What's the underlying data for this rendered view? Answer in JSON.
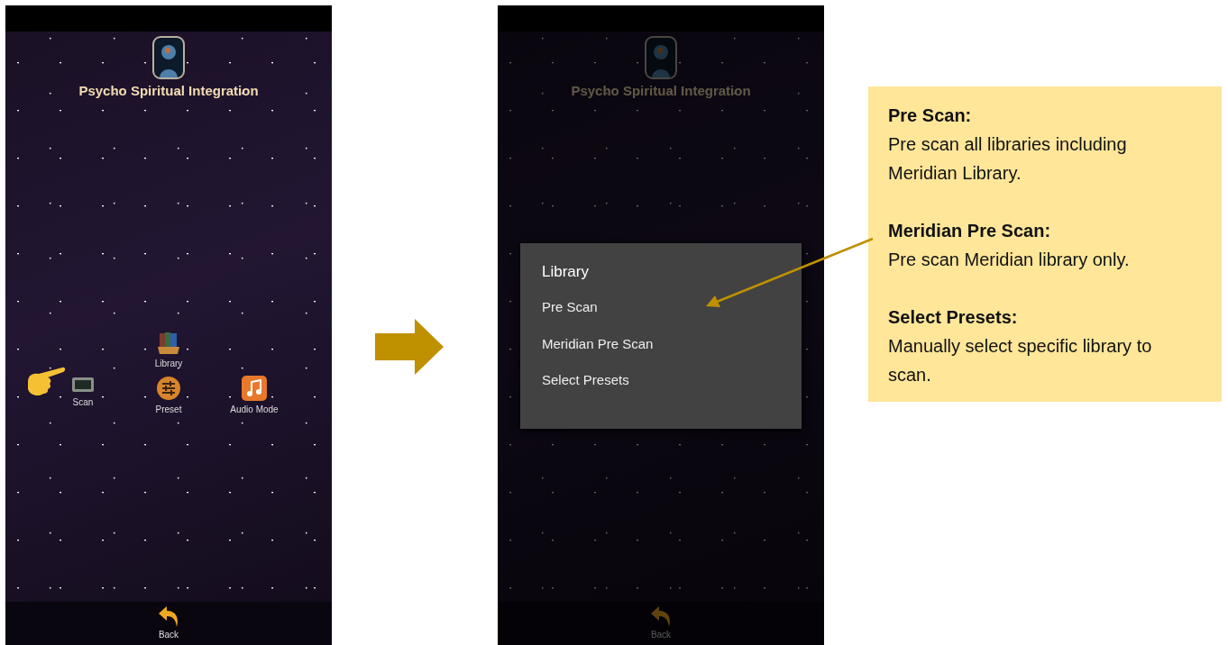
{
  "screens": [
    {
      "dimmed": false,
      "app_title": "Psycho Spiritual Integration",
      "app_rows": [
        [
          {
            "kind": "library",
            "label": "Library",
            "pointed": false
          }
        ],
        [
          {
            "kind": "scan",
            "label": "Scan",
            "pointed": true
          },
          {
            "kind": "preset",
            "label": "Preset",
            "pointed": false
          },
          {
            "kind": "audio",
            "label": "Audio Mode",
            "pointed": false
          }
        ]
      ],
      "back_label": "Back"
    },
    {
      "dimmed": true,
      "app_title": "Psycho Spiritual Integration",
      "dialog": {
        "title": "Library",
        "options": [
          "Pre Scan",
          "Meridian Pre Scan",
          "Select Presets"
        ]
      },
      "back_label": "Back"
    }
  ],
  "callout": {
    "entries": [
      {
        "heading": "Pre Scan:",
        "text": "Pre scan all libraries including Meridian Library."
      },
      {
        "heading": "Meridian Pre Scan:",
        "text": "Pre scan Meridian library only."
      },
      {
        "heading": "Select Presets:",
        "text": "Manually select specific library to scan."
      }
    ]
  }
}
